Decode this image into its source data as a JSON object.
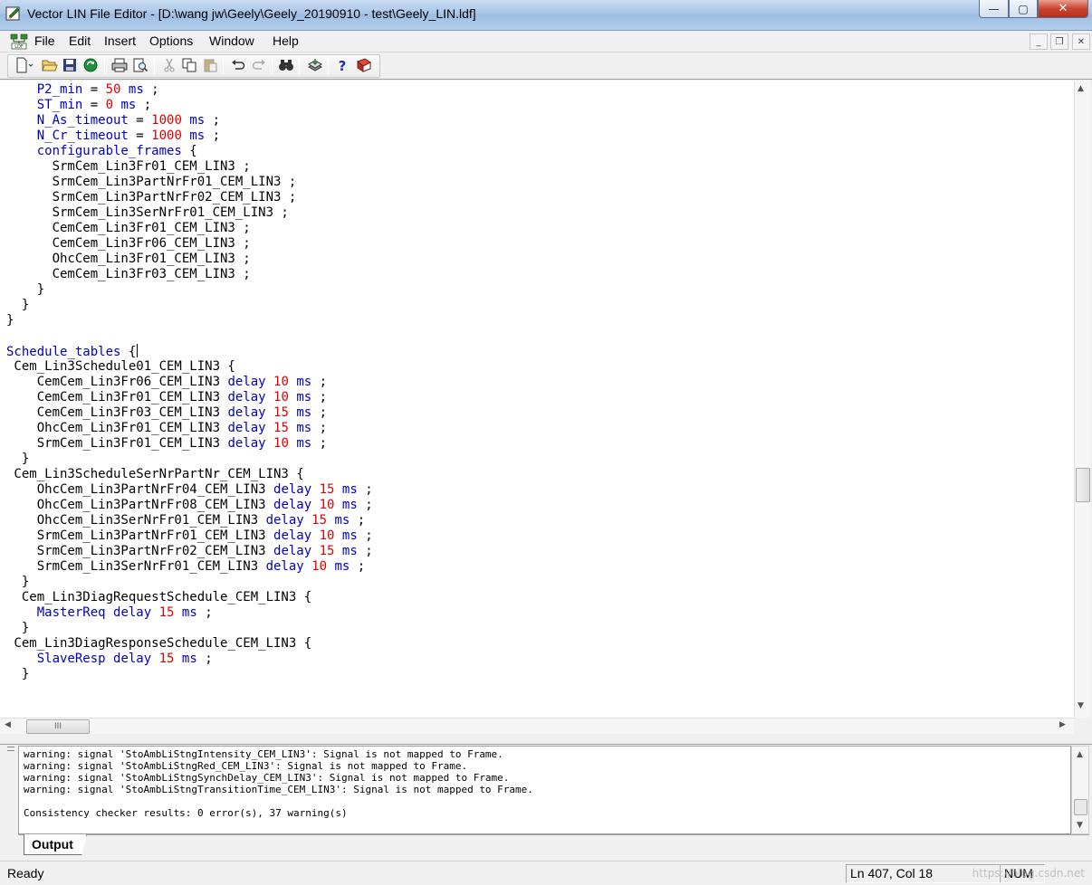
{
  "window": {
    "title": "Vector LIN File Editor - [D:\\wang jw\\Geely\\Geely_20190910 - test\\Geely_LIN.ldf]",
    "minimize_label": "—",
    "maximize_label": "▢",
    "close_label": "✕"
  },
  "menu": {
    "items": [
      "File",
      "Edit",
      "Insert",
      "Options",
      "Window",
      "Help"
    ],
    "mdi_minimize": "_",
    "mdi_restore": "❐",
    "mdi_close": "✕"
  },
  "toolbar": {
    "buttons": [
      "new-document",
      "open-folder",
      "save",
      "refresh",
      "print",
      "print-preview",
      "cut",
      "copy",
      "paste",
      "undo",
      "redo",
      "find",
      "compile",
      "help",
      "manual"
    ]
  },
  "colors": {
    "keyword": "#0000c0",
    "number": "#e00000",
    "text": "#000000"
  },
  "editor": {
    "lines": [
      [
        [
          "    ",
          ""
        ],
        [
          "P2_min",
          "kw"
        ],
        [
          " = ",
          ""
        ],
        [
          "50",
          "num"
        ],
        [
          " ",
          ""
        ],
        [
          "ms",
          "kw"
        ],
        [
          " ;",
          ""
        ]
      ],
      [
        [
          "    ",
          ""
        ],
        [
          "ST_min",
          "kw"
        ],
        [
          " = ",
          ""
        ],
        [
          "0",
          "num"
        ],
        [
          " ",
          ""
        ],
        [
          "ms",
          "kw"
        ],
        [
          " ;",
          ""
        ]
      ],
      [
        [
          "    ",
          ""
        ],
        [
          "N_As_timeout",
          "kw"
        ],
        [
          " = ",
          ""
        ],
        [
          "1000",
          "num"
        ],
        [
          " ",
          ""
        ],
        [
          "ms",
          "kw"
        ],
        [
          " ;",
          ""
        ]
      ],
      [
        [
          "    ",
          ""
        ],
        [
          "N_Cr_timeout",
          "kw"
        ],
        [
          " = ",
          ""
        ],
        [
          "1000",
          "num"
        ],
        [
          " ",
          ""
        ],
        [
          "ms",
          "kw"
        ],
        [
          " ;",
          ""
        ]
      ],
      [
        [
          "    ",
          ""
        ],
        [
          "configurable_frames",
          "kw"
        ],
        [
          " {",
          ""
        ]
      ],
      [
        [
          "      SrmCem_Lin3Fr01_CEM_LIN3 ;",
          ""
        ]
      ],
      [
        [
          "      SrmCem_Lin3PartNrFr01_CEM_LIN3 ;",
          ""
        ]
      ],
      [
        [
          "      SrmCem_Lin3PartNrFr02_CEM_LIN3 ;",
          ""
        ]
      ],
      [
        [
          "      SrmCem_Lin3SerNrFr01_CEM_LIN3 ;",
          ""
        ]
      ],
      [
        [
          "      CemCem_Lin3Fr01_CEM_LIN3 ;",
          ""
        ]
      ],
      [
        [
          "      CemCem_Lin3Fr06_CEM_LIN3 ;",
          ""
        ]
      ],
      [
        [
          "      OhcCem_Lin3Fr01_CEM_LIN3 ;",
          ""
        ]
      ],
      [
        [
          "      CemCem_Lin3Fr03_CEM_LIN3 ;",
          ""
        ]
      ],
      [
        [
          "    }",
          ""
        ]
      ],
      [
        [
          "  }",
          ""
        ]
      ],
      [
        [
          "}",
          ""
        ]
      ],
      [
        [
          "",
          ""
        ]
      ],
      [
        [
          "Schedule_tables",
          "kw"
        ],
        [
          " {",
          ""
        ],
        [
          "|cursor|",
          "cur"
        ]
      ],
      [
        [
          " Cem_Lin3Schedule01_CEM_LIN3 {",
          ""
        ]
      ],
      [
        [
          "    CemCem_Lin3Fr06_CEM_LIN3 ",
          ""
        ],
        [
          "delay",
          "kw"
        ],
        [
          " ",
          ""
        ],
        [
          "10",
          "num"
        ],
        [
          " ",
          ""
        ],
        [
          "ms",
          "kw"
        ],
        [
          " ;",
          ""
        ]
      ],
      [
        [
          "    CemCem_Lin3Fr01_CEM_LIN3 ",
          ""
        ],
        [
          "delay",
          "kw"
        ],
        [
          " ",
          ""
        ],
        [
          "10",
          "num"
        ],
        [
          " ",
          ""
        ],
        [
          "ms",
          "kw"
        ],
        [
          " ;",
          ""
        ]
      ],
      [
        [
          "    CemCem_Lin3Fr03_CEM_LIN3 ",
          ""
        ],
        [
          "delay",
          "kw"
        ],
        [
          " ",
          ""
        ],
        [
          "15",
          "num"
        ],
        [
          " ",
          ""
        ],
        [
          "ms",
          "kw"
        ],
        [
          " ;",
          ""
        ]
      ],
      [
        [
          "    OhcCem_Lin3Fr01_CEM_LIN3 ",
          ""
        ],
        [
          "delay",
          "kw"
        ],
        [
          " ",
          ""
        ],
        [
          "15",
          "num"
        ],
        [
          " ",
          ""
        ],
        [
          "ms",
          "kw"
        ],
        [
          " ;",
          ""
        ]
      ],
      [
        [
          "    SrmCem_Lin3Fr01_CEM_LIN3 ",
          ""
        ],
        [
          "delay",
          "kw"
        ],
        [
          " ",
          ""
        ],
        [
          "10",
          "num"
        ],
        [
          " ",
          ""
        ],
        [
          "ms",
          "kw"
        ],
        [
          " ;",
          ""
        ]
      ],
      [
        [
          "  }",
          ""
        ]
      ],
      [
        [
          " Cem_Lin3ScheduleSerNrPartNr_CEM_LIN3 {",
          ""
        ]
      ],
      [
        [
          "    OhcCem_Lin3PartNrFr04_CEM_LIN3 ",
          ""
        ],
        [
          "delay",
          "kw"
        ],
        [
          " ",
          ""
        ],
        [
          "15",
          "num"
        ],
        [
          " ",
          ""
        ],
        [
          "ms",
          "kw"
        ],
        [
          " ;",
          ""
        ]
      ],
      [
        [
          "    OhcCem_Lin3PartNrFr08_CEM_LIN3 ",
          ""
        ],
        [
          "delay",
          "kw"
        ],
        [
          " ",
          ""
        ],
        [
          "10",
          "num"
        ],
        [
          " ",
          ""
        ],
        [
          "ms",
          "kw"
        ],
        [
          " ;",
          ""
        ]
      ],
      [
        [
          "    OhcCem_Lin3SerNrFr01_CEM_LIN3 ",
          ""
        ],
        [
          "delay",
          "kw"
        ],
        [
          " ",
          ""
        ],
        [
          "15",
          "num"
        ],
        [
          " ",
          ""
        ],
        [
          "ms",
          "kw"
        ],
        [
          " ;",
          ""
        ]
      ],
      [
        [
          "    SrmCem_Lin3PartNrFr01_CEM_LIN3 ",
          ""
        ],
        [
          "delay",
          "kw"
        ],
        [
          " ",
          ""
        ],
        [
          "10",
          "num"
        ],
        [
          " ",
          ""
        ],
        [
          "ms",
          "kw"
        ],
        [
          " ;",
          ""
        ]
      ],
      [
        [
          "    SrmCem_Lin3PartNrFr02_CEM_LIN3 ",
          ""
        ],
        [
          "delay",
          "kw"
        ],
        [
          " ",
          ""
        ],
        [
          "15",
          "num"
        ],
        [
          " ",
          ""
        ],
        [
          "ms",
          "kw"
        ],
        [
          " ;",
          ""
        ]
      ],
      [
        [
          "    SrmCem_Lin3SerNrFr01_CEM_LIN3 ",
          ""
        ],
        [
          "delay",
          "kw"
        ],
        [
          " ",
          ""
        ],
        [
          "10",
          "num"
        ],
        [
          " ",
          ""
        ],
        [
          "ms",
          "kw"
        ],
        [
          " ;",
          ""
        ]
      ],
      [
        [
          "  }",
          ""
        ]
      ],
      [
        [
          "  Cem_Lin3DiagRequestSchedule_CEM_LIN3 {",
          ""
        ]
      ],
      [
        [
          "    ",
          ""
        ],
        [
          "MasterReq",
          "kw"
        ],
        [
          " ",
          ""
        ],
        [
          "delay",
          "kw"
        ],
        [
          " ",
          ""
        ],
        [
          "15",
          "num"
        ],
        [
          " ",
          ""
        ],
        [
          "ms",
          "kw"
        ],
        [
          " ;",
          ""
        ]
      ],
      [
        [
          "  }",
          ""
        ]
      ],
      [
        [
          " Cem_Lin3DiagResponseSchedule_CEM_LIN3 {",
          ""
        ]
      ],
      [
        [
          "    ",
          ""
        ],
        [
          "SlaveResp",
          "kw"
        ],
        [
          " ",
          ""
        ],
        [
          "delay",
          "kw"
        ],
        [
          " ",
          ""
        ],
        [
          "15",
          "num"
        ],
        [
          " ",
          ""
        ],
        [
          "ms",
          "kw"
        ],
        [
          " ;",
          ""
        ]
      ],
      [
        [
          "  }",
          ""
        ]
      ]
    ]
  },
  "scrollbar": {
    "h_thumb_grip": "III"
  },
  "output": {
    "lines": [
      "warning: signal 'StoAmbLiStngIntensity_CEM_LIN3': Signal is not mapped to Frame.",
      "warning: signal 'StoAmbLiStngRed_CEM_LIN3': Signal is not mapped to Frame.",
      "warning: signal 'StoAmbLiStngSynchDelay_CEM_LIN3': Signal is not mapped to Frame.",
      "warning: signal 'StoAmbLiStngTransitionTime_CEM_LIN3': Signal is not mapped to Frame.",
      "",
      "Consistency checker results: 0 error(s), 37 warning(s)"
    ],
    "tab_label": "Output"
  },
  "statusbar": {
    "ready": "Ready",
    "position": "Ln 407, Col 18",
    "num": "NUM",
    "watermark": "https://blog.csdn.net"
  }
}
